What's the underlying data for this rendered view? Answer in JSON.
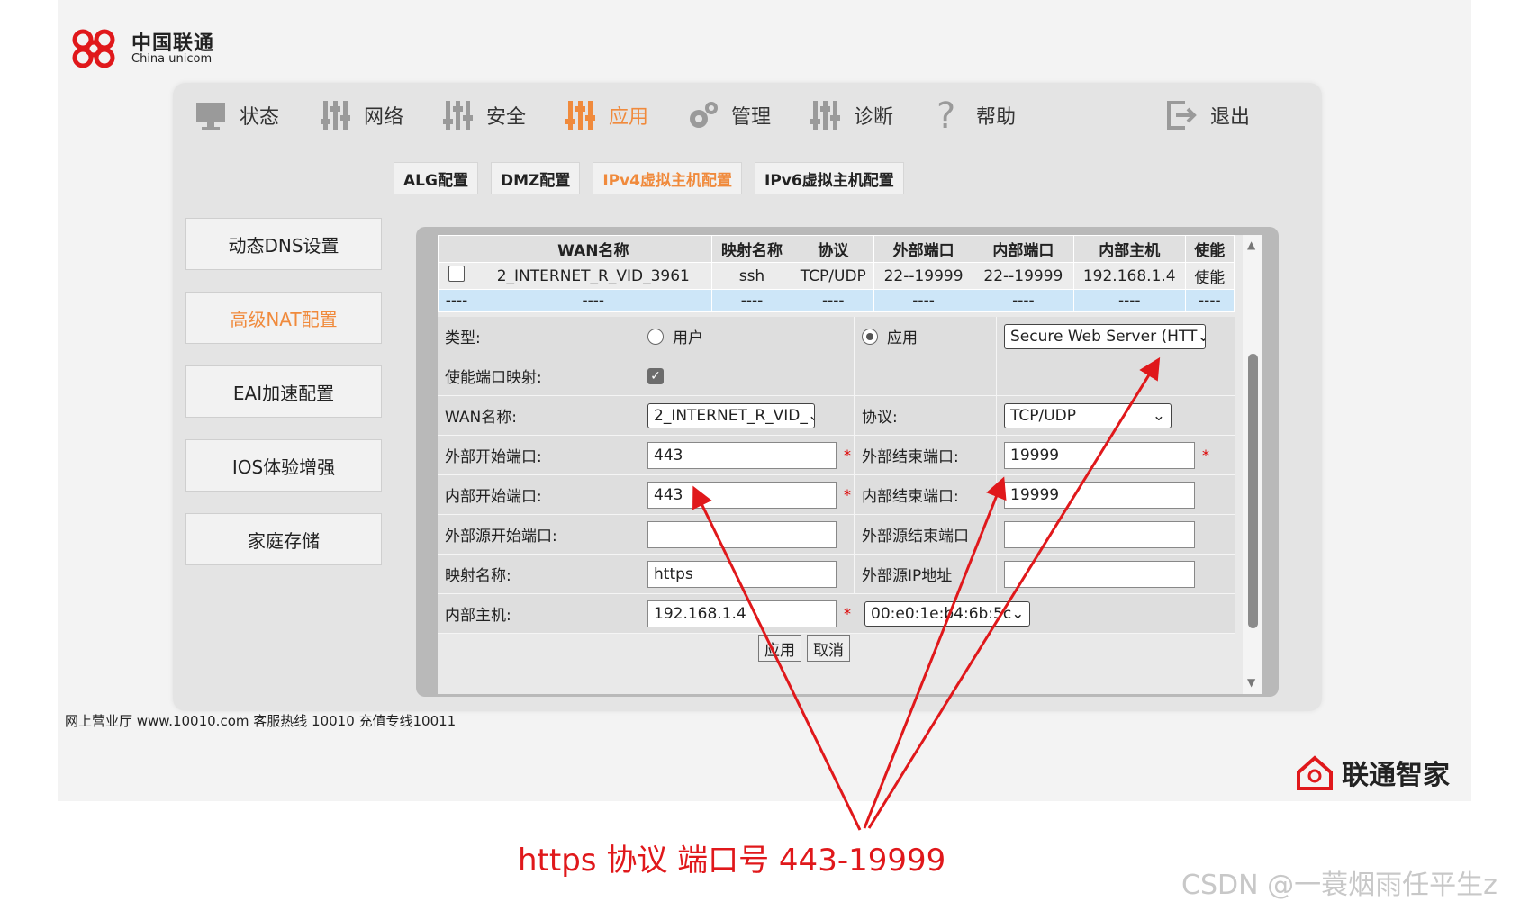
{
  "brand": {
    "logo_cn": "中国联通",
    "logo_en": "China unicom",
    "bottom_logo": "联通智家",
    "footer": "网上营业厅 www.10010.com  客服热线  10010  充值专线10011"
  },
  "nav": {
    "items": [
      {
        "label": "状态",
        "icon": "monitor-icon"
      },
      {
        "label": "网络",
        "icon": "sliders-icon"
      },
      {
        "label": "安全",
        "icon": "sliders-icon"
      },
      {
        "label": "应用",
        "icon": "sliders-icon",
        "active": true
      },
      {
        "label": "管理",
        "icon": "gear-icon"
      },
      {
        "label": "诊断",
        "icon": "sliders-icon"
      },
      {
        "label": "帮助",
        "icon": "question-icon"
      },
      {
        "label": "退出",
        "icon": "logout-icon"
      }
    ]
  },
  "subtabs": [
    "ALG配置",
    "DMZ配置",
    "IPv4虚拟主机配置",
    "IPv6虚拟主机配置"
  ],
  "sidebar": [
    "动态DNS设置",
    "高级NAT配置",
    "EAI加速配置",
    "IOS体验增强",
    "家庭存储"
  ],
  "table": {
    "headers": [
      "",
      "WAN名称",
      "映射名称",
      "协议",
      "外部端口",
      "内部端口",
      "内部主机",
      "使能"
    ],
    "row": [
      "",
      "2_INTERNET_R_VID_3961",
      "ssh",
      "TCP/UDP",
      "22--19999",
      "22--19999",
      "192.168.1.4",
      "使能"
    ],
    "blank_row": [
      "----",
      "----",
      "----",
      "----",
      "----",
      "----",
      "----",
      "----"
    ]
  },
  "form": {
    "type_label": "类型:",
    "type_user": "用户",
    "type_app": "应用",
    "app_select": "Secure Web Server (HTT",
    "enable_label": "使能端口映射:",
    "wan_label": "WAN名称:",
    "wan_select": "2_INTERNET_R_VID_",
    "proto_label": "协议:",
    "proto_select": "TCP/UDP",
    "ext_start_label": "外部开始端口:",
    "ext_start": "443",
    "ext_end_label": "外部结束端口:",
    "ext_end": "19999",
    "int_start_label": "内部开始端口:",
    "int_start": "443",
    "int_end_label": "内部结束端口:",
    "int_end": "19999",
    "src_start_label": "外部源开始端口:",
    "src_end_label": "外部源结束端口",
    "map_name_label": "映射名称:",
    "map_name": "https",
    "src_ip_label": "外部源IP地址",
    "host_label": "内部主机:",
    "host": "192.168.1.4",
    "mac_select": "00:e0:1e:b4:6b:5c",
    "apply": "应用",
    "cancel": "取消"
  },
  "annotation": {
    "caption": "https 协议 端口号 443-19999",
    "watermark": "CSDN @一蓑烟雨任平生z",
    "color": "#e0181b"
  },
  "colors": {
    "accent": "#f08a3c",
    "brand_red": "#e0181b"
  }
}
